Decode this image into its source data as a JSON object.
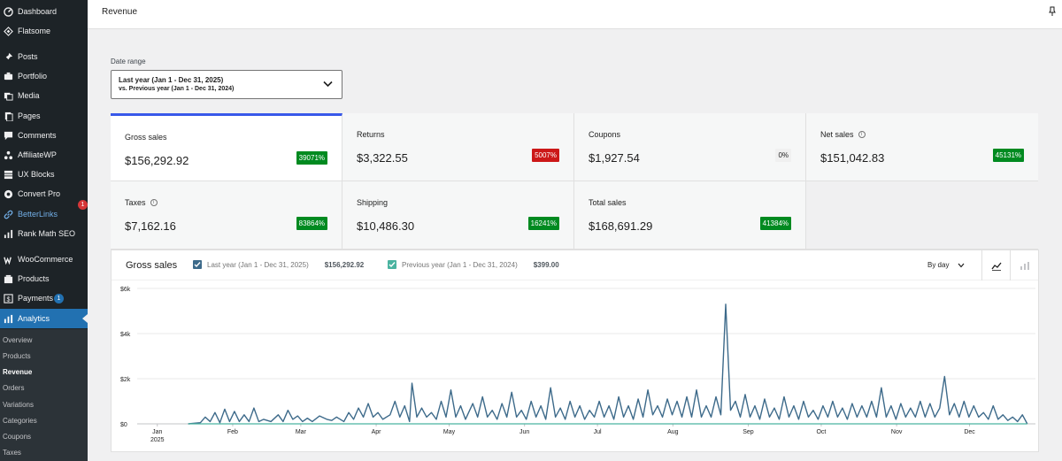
{
  "sidebar": {
    "items": [
      {
        "label": "Dashboard",
        "icon": "dashboard-icon"
      },
      {
        "label": "Flatsome",
        "icon": "flatsome-icon"
      },
      {
        "label": "Posts",
        "icon": "pin-icon"
      },
      {
        "label": "Portfolio",
        "icon": "portfolio-icon"
      },
      {
        "label": "Media",
        "icon": "media-icon"
      },
      {
        "label": "Pages",
        "icon": "pages-icon"
      },
      {
        "label": "Comments",
        "icon": "comments-icon"
      },
      {
        "label": "AffiliateWP",
        "icon": "affiliatewp-icon"
      },
      {
        "label": "UX Blocks",
        "icon": "ux-blocks-icon"
      },
      {
        "label": "Convert Pro",
        "icon": "convert-pro-icon"
      },
      {
        "label": "BetterLinks",
        "icon": "link-icon",
        "badge": "1"
      },
      {
        "label": "Rank Math SEO",
        "icon": "rank-math-icon"
      },
      {
        "label": "WooCommerce",
        "icon": "woocommerce-icon"
      },
      {
        "label": "Products",
        "icon": "products-icon"
      },
      {
        "label": "Payments",
        "icon": "payments-icon",
        "badge": "1"
      },
      {
        "label": "Analytics",
        "icon": "analytics-icon"
      }
    ],
    "submenu": [
      "Overview",
      "Products",
      "Revenue",
      "Orders",
      "Variations",
      "Categories",
      "Coupons",
      "Taxes"
    ]
  },
  "header": {
    "title": "Revenue"
  },
  "date_range": {
    "label": "Date range",
    "main": "Last year (Jan 1 - Dec 31, 2025)",
    "compare": "vs. Previous year (Jan 1 - Dec 31, 2024)"
  },
  "cards": [
    {
      "label": "Gross sales",
      "value": "$156,292.92",
      "delta": "39071%",
      "trend": "up",
      "info": false
    },
    {
      "label": "Returns",
      "value": "$3,322.55",
      "delta": "5007%",
      "trend": "down",
      "info": false
    },
    {
      "label": "Coupons",
      "value": "$1,927.54",
      "delta": "0%",
      "trend": "flat",
      "info": false
    },
    {
      "label": "Net sales",
      "value": "$151,042.83",
      "delta": "45131%",
      "trend": "up",
      "info": true
    },
    {
      "label": "Taxes",
      "value": "$7,162.16",
      "delta": "83864%",
      "trend": "up",
      "info": true
    },
    {
      "label": "Shipping",
      "value": "$10,486.30",
      "delta": "16241%",
      "trend": "up",
      "info": false
    },
    {
      "label": "Total sales",
      "value": "$168,691.29",
      "delta": "41384%",
      "trend": "up",
      "info": false
    }
  ],
  "chart_header": {
    "title": "Gross sales",
    "legend": [
      {
        "label": "Last year (Jan 1 - Dec 31, 2025)",
        "value": "$156,292.92",
        "color": "#3d6a8a"
      },
      {
        "label": "Previous year (Jan 1 - Dec 31, 2024)",
        "value": "$399.00",
        "color": "#4ab3a0"
      }
    ],
    "interval": "By day"
  },
  "colors": {
    "accent": "#3858e9",
    "up": "#008a20",
    "down": "#cc1818",
    "sidebar_active": "#2271b1",
    "series1": "#3d6a8a",
    "series2": "#4ab3a0"
  },
  "chart_data": {
    "type": "line",
    "title": "Gross sales",
    "y_ticks": [
      "$6k",
      "$4k",
      "$2k",
      "$0"
    ],
    "ylim": [
      0,
      6000
    ],
    "x_tick_labels": [
      "Jan",
      "Feb",
      "Mar",
      "Apr",
      "May",
      "Jun",
      "Jul",
      "Aug",
      "Sep",
      "Oct",
      "Nov",
      "Dec"
    ],
    "x_year_label": "2025",
    "grid": true,
    "series": [
      {
        "name": "Last year (Jan 1 - Dec 31, 2025)",
        "points": [
          [
            1,
            0
          ],
          [
            6,
            50
          ],
          [
            8,
            300
          ],
          [
            10,
            100
          ],
          [
            12,
            500
          ],
          [
            14,
            50
          ],
          [
            16,
            650
          ],
          [
            18,
            100
          ],
          [
            20,
            550
          ],
          [
            22,
            100
          ],
          [
            24,
            400
          ],
          [
            26,
            100
          ],
          [
            28,
            700
          ],
          [
            30,
            100
          ],
          [
            32,
            200
          ],
          [
            35,
            100
          ],
          [
            38,
            400
          ],
          [
            40,
            100
          ],
          [
            42,
            600
          ],
          [
            44,
            200
          ],
          [
            46,
            350
          ],
          [
            48,
            100
          ],
          [
            50,
            250
          ],
          [
            52,
            100
          ],
          [
            55,
            350
          ],
          [
            58,
            200
          ],
          [
            60,
            150
          ],
          [
            62,
            300
          ],
          [
            65,
            100
          ],
          [
            67,
            500
          ],
          [
            69,
            200
          ],
          [
            71,
            700
          ],
          [
            73,
            300
          ],
          [
            75,
            900
          ],
          [
            77,
            300
          ],
          [
            79,
            500
          ],
          [
            81,
            200
          ],
          [
            84,
            400
          ],
          [
            86,
            1000
          ],
          [
            88,
            300
          ],
          [
            90,
            800
          ],
          [
            92,
            100
          ],
          [
            93,
            1800
          ],
          [
            95,
            300
          ],
          [
            97,
            700
          ],
          [
            99,
            300
          ],
          [
            101,
            500
          ],
          [
            103,
            200
          ],
          [
            105,
            1000
          ],
          [
            107,
            300
          ],
          [
            109,
            1500
          ],
          [
            111,
            300
          ],
          [
            113,
            800
          ],
          [
            115,
            200
          ],
          [
            118,
            900
          ],
          [
            120,
            300
          ],
          [
            122,
            1200
          ],
          [
            124,
            300
          ],
          [
            126,
            600
          ],
          [
            128,
            200
          ],
          [
            130,
            900
          ],
          [
            132,
            300
          ],
          [
            134,
            1400
          ],
          [
            136,
            300
          ],
          [
            138,
            600
          ],
          [
            140,
            200
          ],
          [
            142,
            1000
          ],
          [
            144,
            300
          ],
          [
            146,
            800
          ],
          [
            148,
            200
          ],
          [
            150,
            1600
          ],
          [
            152,
            300
          ],
          [
            154,
            700
          ],
          [
            156,
            200
          ],
          [
            158,
            1000
          ],
          [
            160,
            300
          ],
          [
            162,
            800
          ],
          [
            164,
            200
          ],
          [
            166,
            600
          ],
          [
            168,
            300
          ],
          [
            170,
            1000
          ],
          [
            172,
            300
          ],
          [
            174,
            800
          ],
          [
            176,
            200
          ],
          [
            178,
            1200
          ],
          [
            180,
            300
          ],
          [
            182,
            800
          ],
          [
            184,
            200
          ],
          [
            186,
            1100
          ],
          [
            188,
            300
          ],
          [
            190,
            1500
          ],
          [
            192,
            400
          ],
          [
            194,
            800
          ],
          [
            196,
            300
          ],
          [
            198,
            1100
          ],
          [
            200,
            400
          ],
          [
            202,
            1000
          ],
          [
            204,
            300
          ],
          [
            206,
            1200
          ],
          [
            208,
            300
          ],
          [
            210,
            1500
          ],
          [
            212,
            300
          ],
          [
            214,
            800
          ],
          [
            216,
            300
          ],
          [
            218,
            1200
          ],
          [
            220,
            400
          ],
          [
            222,
            5300
          ],
          [
            224,
            600
          ],
          [
            226,
            1000
          ],
          [
            228,
            300
          ],
          [
            230,
            1300
          ],
          [
            232,
            300
          ],
          [
            234,
            800
          ],
          [
            236,
            200
          ],
          [
            238,
            1100
          ],
          [
            240,
            300
          ],
          [
            242,
            700
          ],
          [
            244,
            200
          ],
          [
            246,
            1200
          ],
          [
            248,
            300
          ],
          [
            250,
            800
          ],
          [
            252,
            200
          ],
          [
            254,
            1000
          ],
          [
            256,
            300
          ],
          [
            258,
            600
          ],
          [
            260,
            200
          ],
          [
            262,
            800
          ],
          [
            264,
            300
          ],
          [
            266,
            1000
          ],
          [
            268,
            300
          ],
          [
            270,
            700
          ],
          [
            272,
            200
          ],
          [
            274,
            900
          ],
          [
            276,
            300
          ],
          [
            278,
            800
          ],
          [
            280,
            300
          ],
          [
            282,
            1000
          ],
          [
            284,
            300
          ],
          [
            286,
            1600
          ],
          [
            288,
            300
          ],
          [
            290,
            800
          ],
          [
            292,
            200
          ],
          [
            294,
            900
          ],
          [
            296,
            300
          ],
          [
            298,
            700
          ],
          [
            300,
            300
          ],
          [
            302,
            1000
          ],
          [
            304,
            300
          ],
          [
            306,
            900
          ],
          [
            308,
            300
          ],
          [
            310,
            700
          ],
          [
            312,
            2100
          ],
          [
            314,
            400
          ],
          [
            316,
            900
          ],
          [
            318,
            300
          ],
          [
            320,
            1000
          ],
          [
            322,
            300
          ],
          [
            324,
            800
          ],
          [
            326,
            300
          ],
          [
            328,
            500
          ],
          [
            330,
            200
          ],
          [
            332,
            800
          ],
          [
            334,
            200
          ],
          [
            336,
            400
          ],
          [
            338,
            150
          ],
          [
            340,
            300
          ],
          [
            342,
            100
          ],
          [
            344,
            400
          ],
          [
            346,
            0
          ]
        ]
      },
      {
        "name": "Previous year (Jan 1 - Dec 31, 2024)",
        "points": [
          [
            1,
            0
          ],
          [
            346,
            0
          ]
        ]
      }
    ]
  }
}
